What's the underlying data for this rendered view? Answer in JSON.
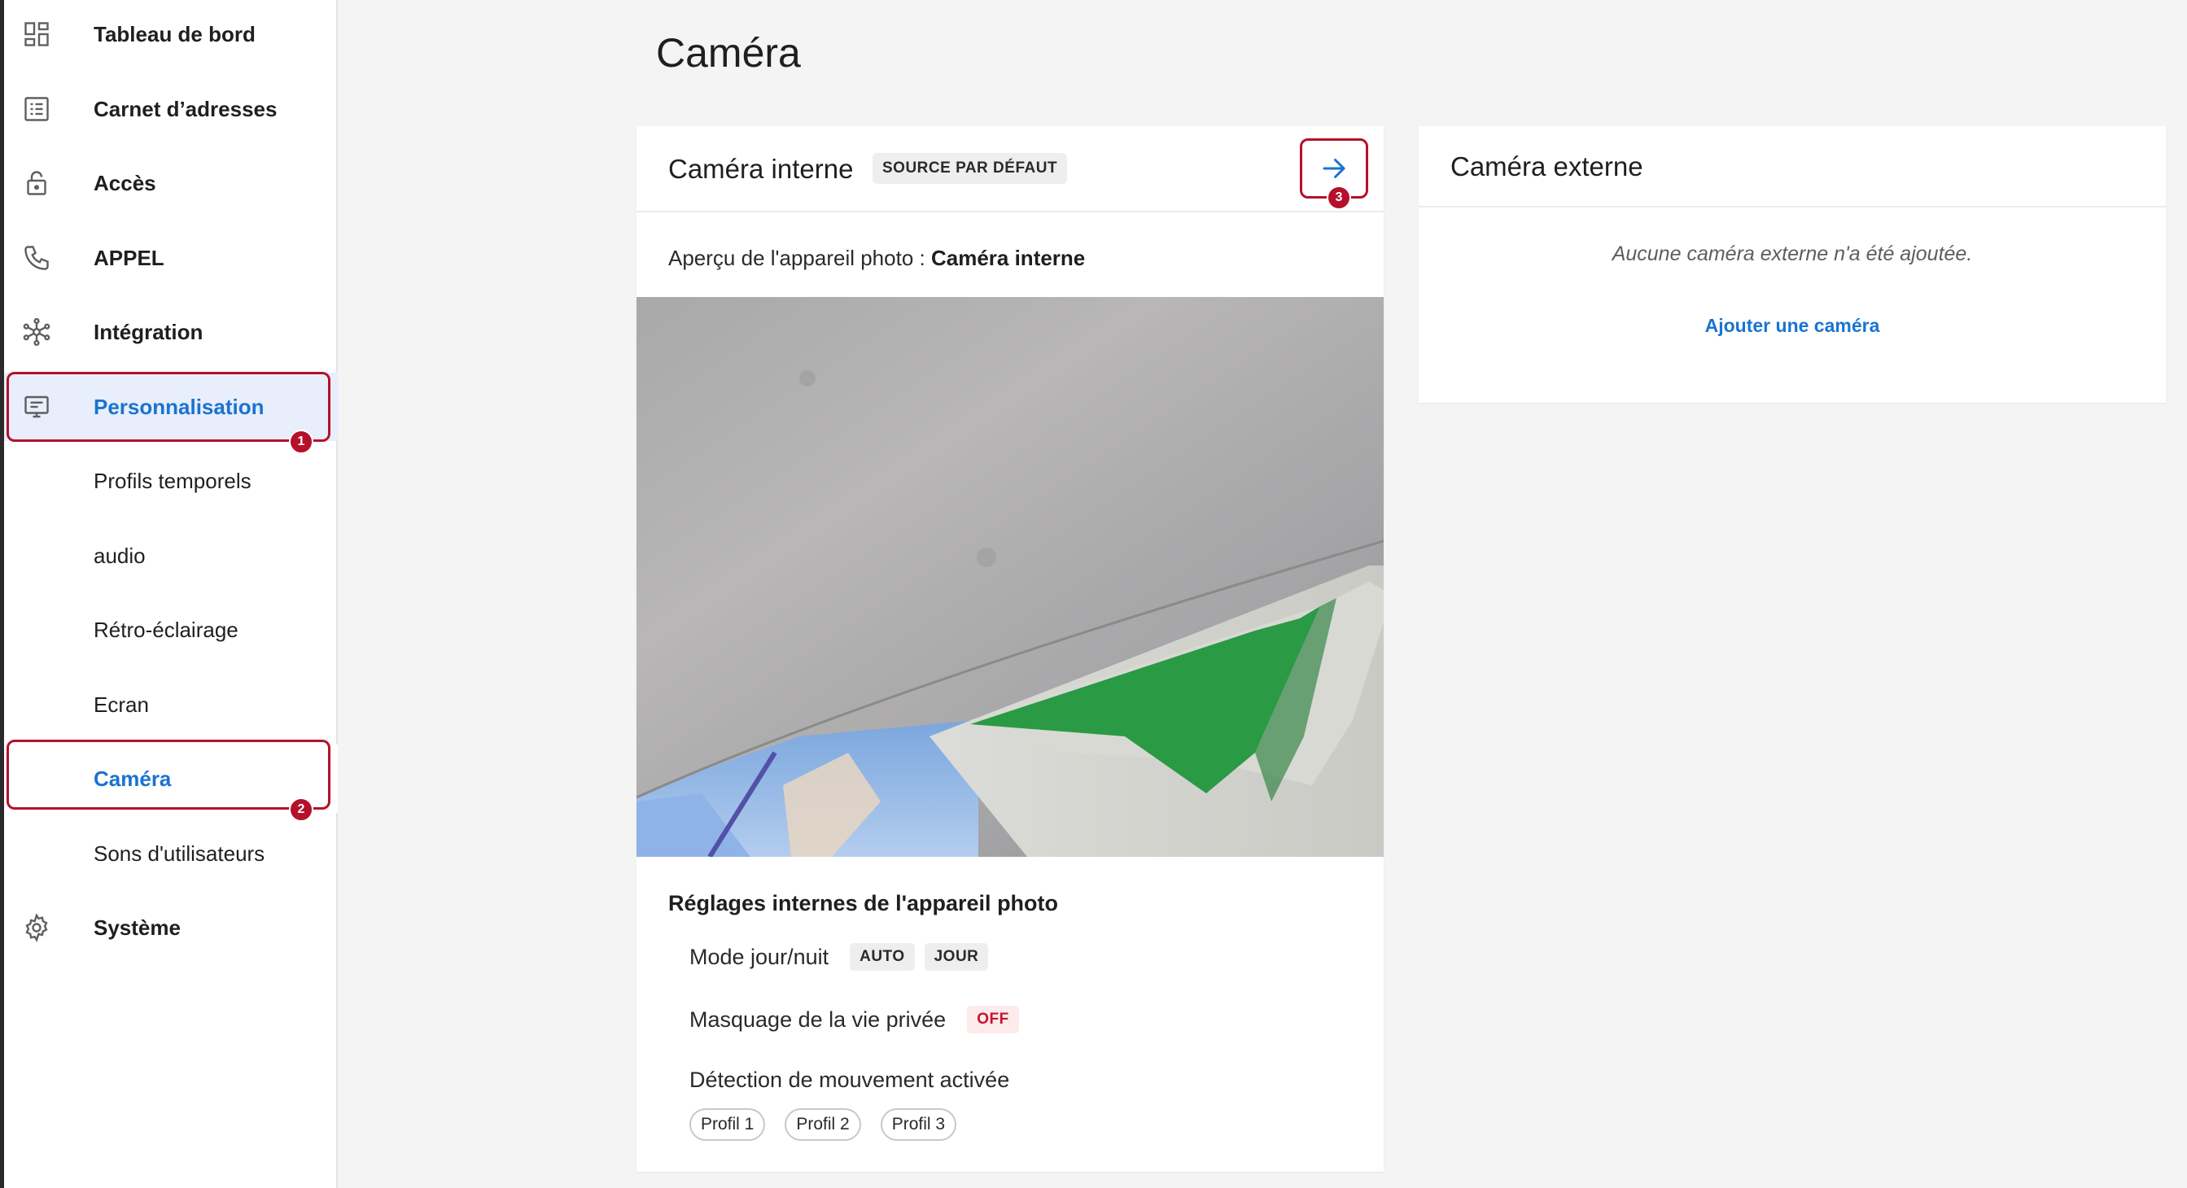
{
  "sidebar": {
    "items": [
      {
        "label": "Tableau de bord",
        "icon": "dashboard-icon"
      },
      {
        "label": "Carnet d’adresses",
        "icon": "address-book-icon"
      },
      {
        "label": "Accès",
        "icon": "lock-icon"
      },
      {
        "label": "APPEL",
        "icon": "phone-icon"
      },
      {
        "label": "Intégration",
        "icon": "integration-icon"
      },
      {
        "label": "Personnalisation",
        "icon": "display-icon"
      },
      {
        "label": "Profils temporels"
      },
      {
        "label": "audio"
      },
      {
        "label": "Rétro-éclairage"
      },
      {
        "label": "Ecran"
      },
      {
        "label": "Caméra"
      },
      {
        "label": "Sons d'utilisateurs"
      },
      {
        "label": "Système",
        "icon": "gear-icon"
      }
    ]
  },
  "annotations": {
    "step1": "1",
    "step2": "2",
    "step3": "3"
  },
  "page": {
    "title": "Caméra"
  },
  "internal_camera": {
    "title": "Caméra interne",
    "default_tag": "SOURCE PAR DÉFAUT",
    "preview_prefix": "Aperçu de l'appareil photo : ",
    "preview_source": "Caméra interne",
    "settings_title": "Réglages internes de l'appareil photo",
    "day_night_label": "Mode jour/nuit",
    "day_night_options": [
      "AUTO",
      "JOUR"
    ],
    "privacy_label": "Masquage de la vie privée",
    "privacy_value": "OFF",
    "motion_label": "Détection de mouvement activée",
    "profiles": [
      "Profil 1",
      "Profil 2",
      "Profil 3"
    ]
  },
  "external_camera": {
    "title": "Caméra externe",
    "empty_message": "Aucune caméra externe n'a été ajoutée.",
    "add_link": "Ajouter une caméra"
  },
  "colors": {
    "accent": "#1a73d1",
    "highlight": "#b5112a",
    "active_bg": "#e8eefb"
  }
}
